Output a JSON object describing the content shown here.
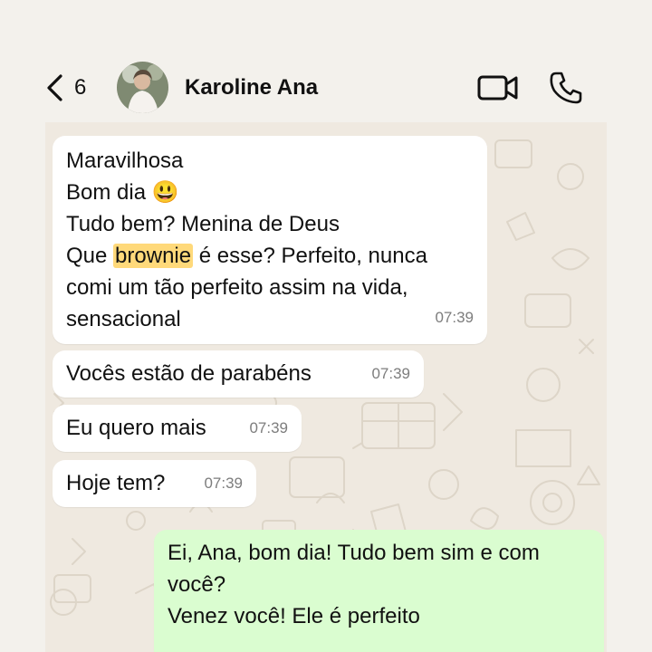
{
  "header": {
    "back_count": "6",
    "contact_name": "Karoline Ana",
    "icons": {
      "back": "chevron-left-icon",
      "video": "video-call-icon",
      "call": "phone-icon"
    }
  },
  "messages": [
    {
      "direction": "in",
      "lines": [
        "Maravilhosa",
        "Bom dia",
        "Tudo bem? Menina de Deus",
        "Que",
        "brownie",
        "é esse? Perfeito, nunca",
        "comi um tão perfeito assim na vida,",
        "sensacional"
      ],
      "emoji": "😃",
      "time": "07:39"
    },
    {
      "direction": "in",
      "text": "Vocês estão de parabéns",
      "time": "07:39"
    },
    {
      "direction": "in",
      "text": "Eu quero mais",
      "time": "07:39"
    },
    {
      "direction": "in",
      "text": "Hoje tem?",
      "time": "07:39"
    },
    {
      "direction": "out",
      "lines": [
        "Ei, Ana, bom dia! Tudo bem sim e com",
        "você?",
        "Venez você! Ele é perfeito"
      ]
    }
  ],
  "colors": {
    "incoming_bubble": "#ffffff",
    "outgoing_bubble": "#dafdd0",
    "highlight": "#ffd97a",
    "chat_background": "#efe9e0"
  }
}
